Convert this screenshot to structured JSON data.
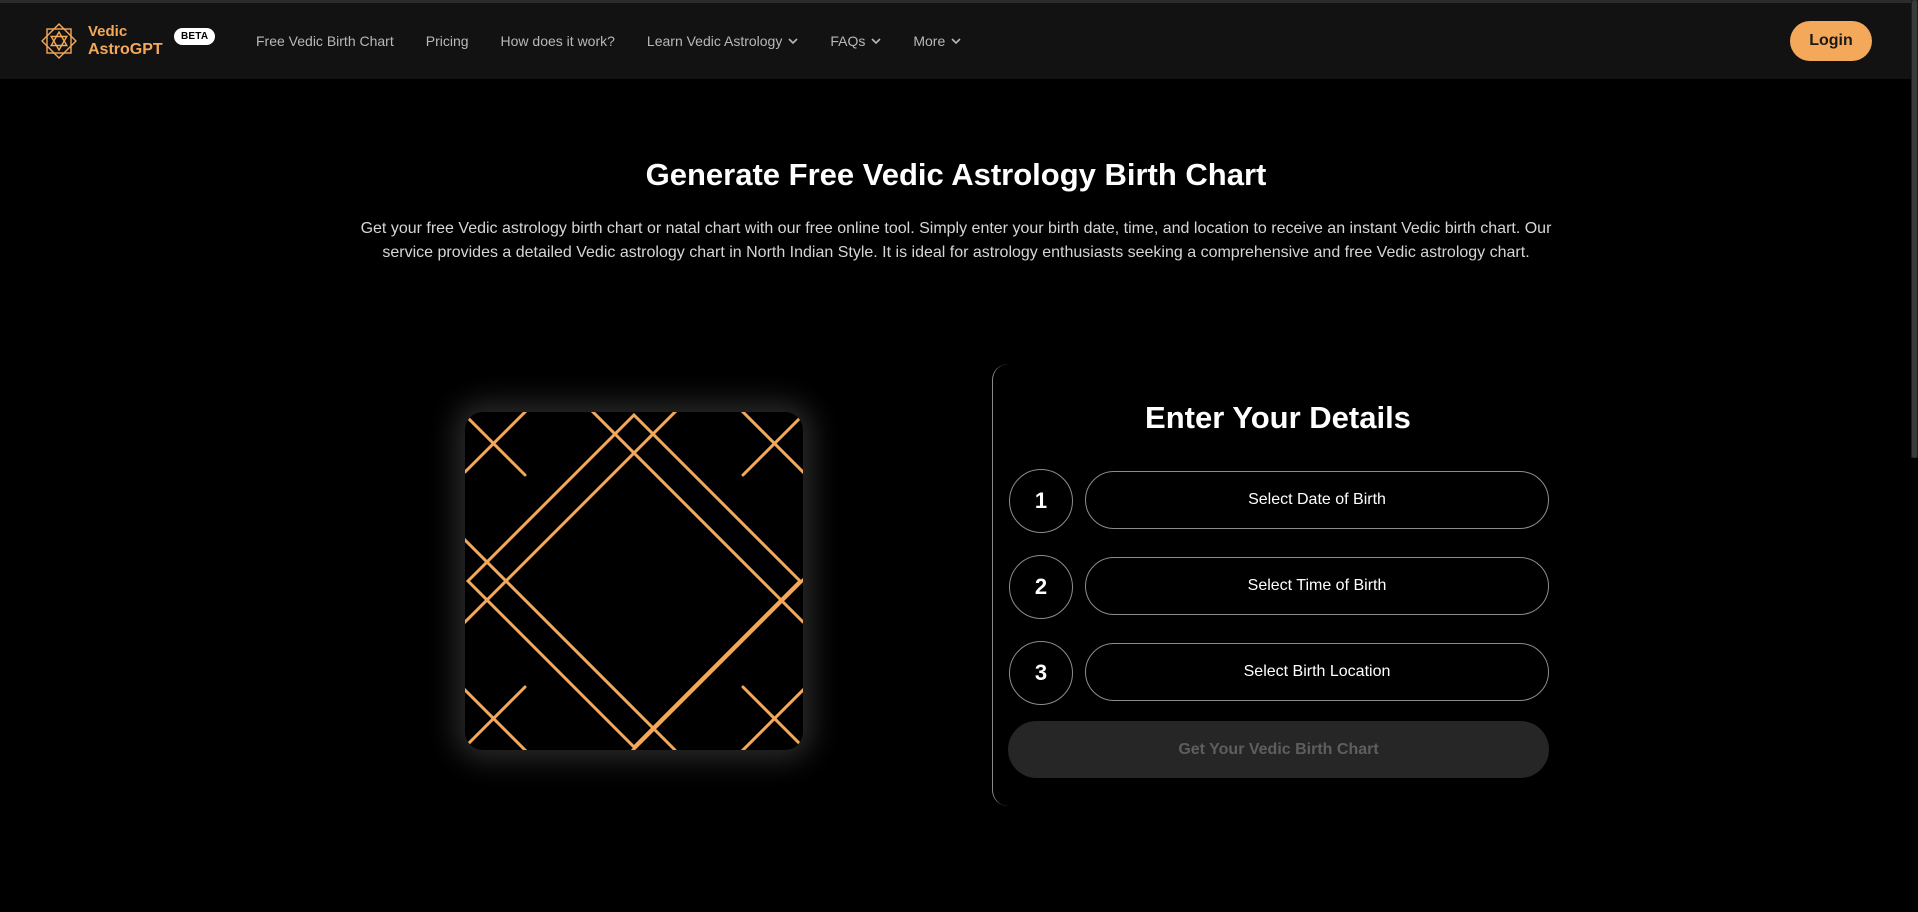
{
  "brand": {
    "line1": "Vedic",
    "line2": "AstroGPT",
    "badge": "BETA",
    "logo_icon": "star-of-david-icon",
    "accent_color": "#f4a85a"
  },
  "nav": {
    "items": [
      {
        "label": "Free Vedic Birth Chart",
        "has_dropdown": false
      },
      {
        "label": "Pricing",
        "has_dropdown": false
      },
      {
        "label": "How does it work?",
        "has_dropdown": false
      },
      {
        "label": "Learn Vedic Astrology",
        "has_dropdown": true
      },
      {
        "label": "FAQs",
        "has_dropdown": true
      },
      {
        "label": "More",
        "has_dropdown": true
      }
    ],
    "login_label": "Login"
  },
  "hero": {
    "title": "Generate Free Vedic Astrology Birth Chart",
    "description": "Get your free Vedic astrology birth chart or natal chart with our free online tool. Simply enter your birth date, time, and location to receive an instant Vedic birth chart. Our service provides a detailed Vedic astrology chart in North Indian Style. It is ideal for astrology enthusiasts seeking a comprehensive and free Vedic astrology chart."
  },
  "chart_preview": {
    "style": "north-indian-chart-icon",
    "line_color": "#f4a85a"
  },
  "form": {
    "title": "Enter Your Details",
    "steps": [
      {
        "number": "1",
        "label": "Select Date of Birth"
      },
      {
        "number": "2",
        "label": "Select Time of Birth"
      },
      {
        "number": "3",
        "label": "Select Birth Location"
      }
    ],
    "submit_label": "Get Your Vedic Birth Chart",
    "submit_enabled": false
  }
}
